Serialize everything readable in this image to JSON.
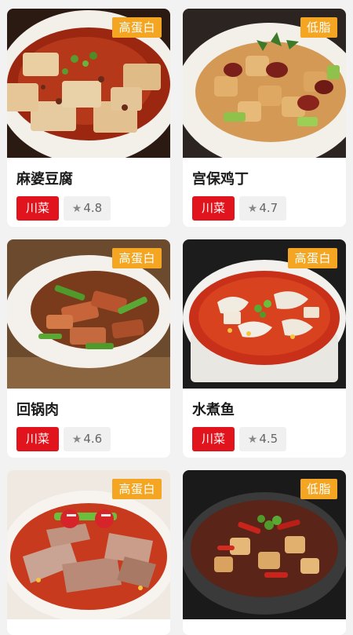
{
  "dishes": [
    {
      "name": "麻婆豆腐",
      "tag": "高蛋白",
      "cuisine": "川菜",
      "rating": "4.8",
      "photo_icon": "mapo-tofu-photo"
    },
    {
      "name": "宫保鸡丁",
      "tag": "低脂",
      "cuisine": "川菜",
      "rating": "4.7",
      "photo_icon": "kung-pao-chicken-photo"
    },
    {
      "name": "回锅肉",
      "tag": "高蛋白",
      "cuisine": "川菜",
      "rating": "4.6",
      "photo_icon": "twice-cooked-pork-photo"
    },
    {
      "name": "水煮鱼",
      "tag": "高蛋白",
      "cuisine": "川菜",
      "rating": "4.5",
      "photo_icon": "boiled-fish-photo"
    },
    {
      "name": "",
      "tag": "高蛋白",
      "cuisine": "",
      "rating": "",
      "photo_icon": "sliced-beef-photo"
    },
    {
      "name": "",
      "tag": "低脂",
      "cuisine": "",
      "rating": "",
      "photo_icon": "stir-fried-chicken-photo"
    }
  ],
  "rating_star": "★",
  "colors": {
    "tag_bg": "#f4a623",
    "cuisine_bg": "#e1141e",
    "rating_bg": "#f0f0f0",
    "page_bg": "#f2f2f2"
  }
}
